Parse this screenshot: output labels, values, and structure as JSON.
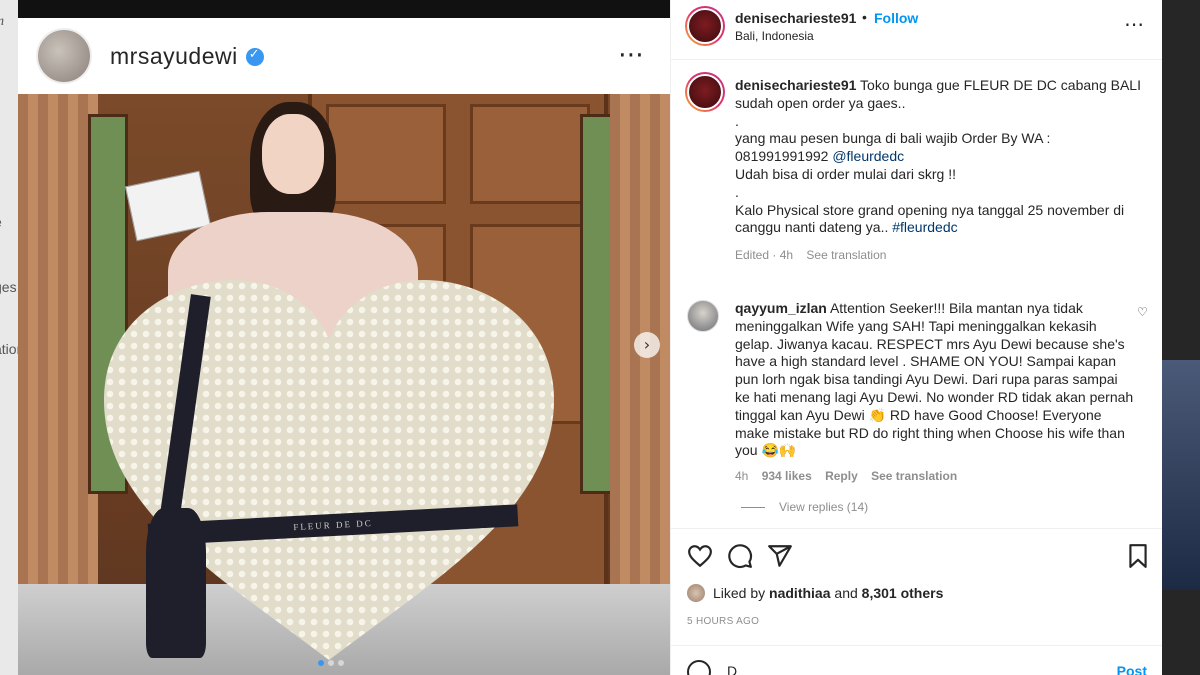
{
  "background_page": {
    "edge_fragments": [
      "m",
      "e",
      "ges",
      "ation"
    ]
  },
  "post": {
    "username": "mrsayudewi",
    "verified": true,
    "more_icon": "⋯",
    "ribbon_text": "FLEUR DE DC",
    "carousel_next_icon": "›",
    "carousel_dots": 3,
    "carousel_active": 0
  },
  "sidebar": {
    "header": {
      "username": "denisecharieste91",
      "separator": "•",
      "follow_label": "Follow",
      "location": "Bali, Indonesia",
      "more_icon": "⋯"
    },
    "caption": {
      "username": "denisecharieste91",
      "lines": [
        "Toko bunga gue FLEUR DE DC cabang BALI sudah open order ya gaes..",
        ".",
        "yang mau pesen bunga di bali wajib Order By WA : 081991991992 ",
        "",
        "Udah bisa di order mulai dari skrg !!",
        ".",
        "Kalo Physical store grand opening nya tanggal 25 november di canggu nanti dateng ya.. "
      ],
      "mention": "@fleurdedc",
      "hashtag": "#fleurdedc",
      "edited": "Edited · 4h",
      "see_translation": "See translation"
    },
    "comment": {
      "username": "qayyum_izlan",
      "text": "Attention Seeker!!! Bila mantan nya tidak meninggalkan Wife yang SAH! Tapi meninggalkan kekasih gelap. Jiwanya kacau. RESPECT mrs Ayu Dewi because she's have a high standard level . SHAME ON YOU! Sampai kapan pun lorh ngak bisa tandingi Ayu Dewi. Dari rupa paras sampai ke hati menang lagi Ayu Dewi. No wonder RD tidak akan pernah tinggal kan Ayu Dewi 👏 RD have Good Choose! Everyone make mistake but RD do right thing when Choose his wife than you 😂🙌",
      "time": "4h",
      "likes": "934 likes",
      "reply": "Reply",
      "see_translation": "See translation",
      "heart_icon": "♡",
      "view_replies": "View replies (14)"
    },
    "liked_by": {
      "prefix": "Liked by ",
      "user": "nadithiaa",
      "middle": " and ",
      "others": "8,301 others"
    },
    "time_ago": "5 HOURS AGO",
    "add_comment": {
      "value": "D",
      "post_label": "Post"
    }
  }
}
